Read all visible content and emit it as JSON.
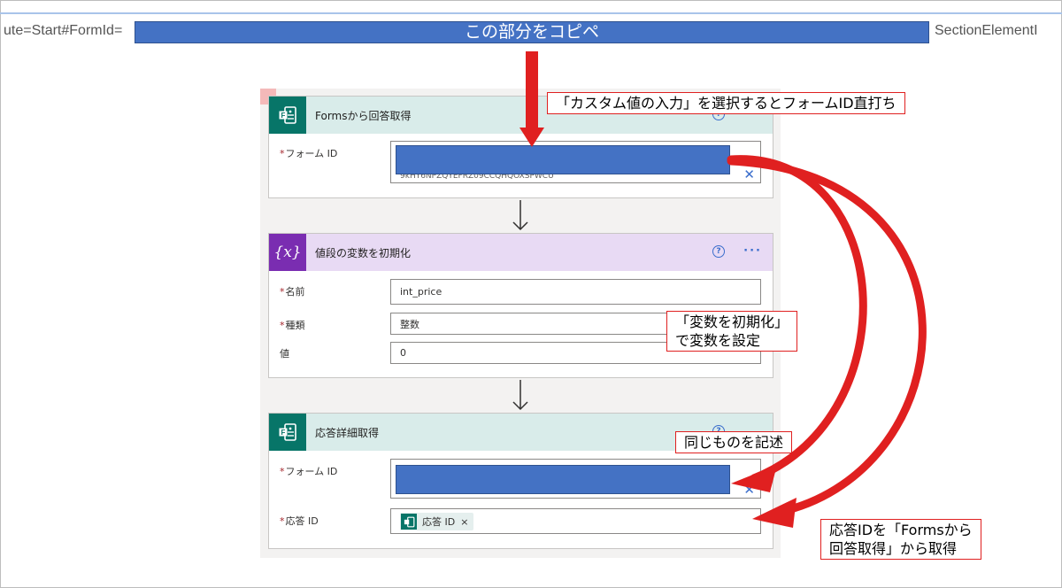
{
  "url": {
    "left_text": "ute=Start#FormId=",
    "right_text": "SectionElementI",
    "highlight_label": "この部分をコピペ"
  },
  "cards": {
    "forms_get": {
      "title": "Formsから回答取得",
      "form_id_label": "フォーム ID",
      "form_id_value": "9kHY6NPZQYEFRZ09CCQHQOXSPWCU"
    },
    "init_variable": {
      "title": "値段の変数を初期化",
      "icon_text": "{x}",
      "name_label": "名前",
      "name_value": "int_price",
      "type_label": "種類",
      "type_value": "整数",
      "value_label": "値",
      "value_value": "0"
    },
    "response_details": {
      "title": "応答詳細取得",
      "form_id_label": "フォーム ID",
      "response_id_label": "応答 ID",
      "response_token_label": "応答 ID",
      "token_remove": "×"
    }
  },
  "common": {
    "required_mark": "*",
    "help_icon_text": "?",
    "more_text": "···",
    "clear_text": "✕"
  },
  "callouts": {
    "custom_value": "「カスタム値の入力」を選択するとフォームID直打ち",
    "init_variable_line1": "「変数を初期化」",
    "init_variable_line2": "で変数を設定",
    "same_thing": "同じものを記述",
    "response_id_line1": "応答IDを「Formsから",
    "response_id_line2": "回答取得」から取得"
  },
  "colors": {
    "highlight_blue": "#4472c4",
    "annotation_red": "#e02020",
    "forms_teal": "#077568",
    "variable_purple": "#7a2db1"
  },
  "icons": {
    "forms_icon": "microsoft-forms-icon",
    "variable_icon": "variable-icon",
    "flow_arrow": "down-arrow-icon"
  }
}
